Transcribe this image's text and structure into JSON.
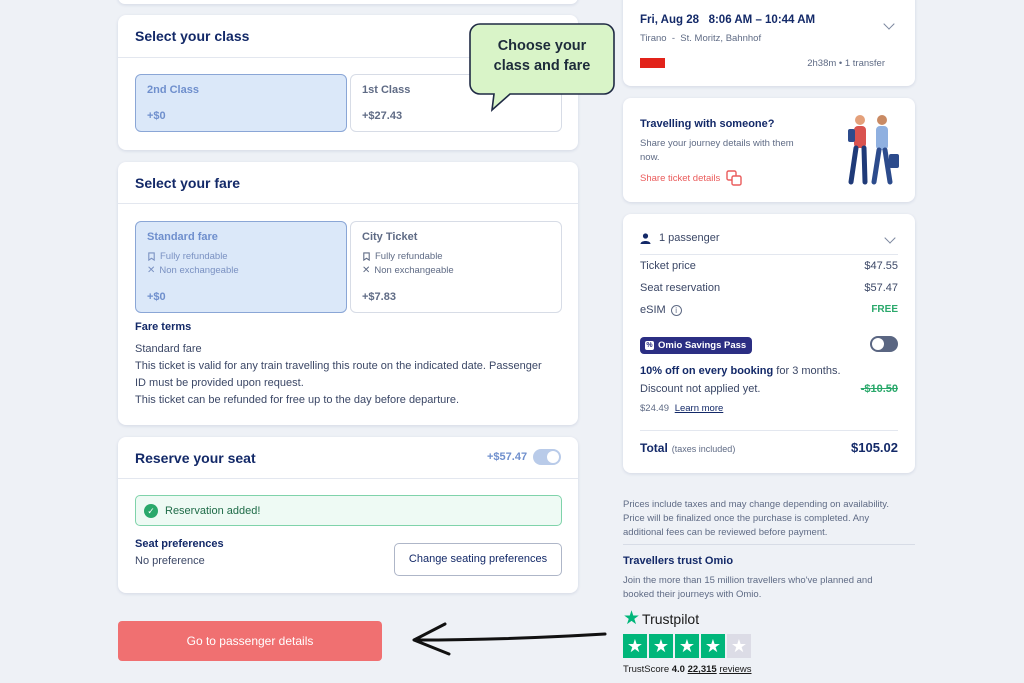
{
  "class_section": {
    "title": "Select your class",
    "options": [
      {
        "name": "2nd Class",
        "price": "+$0"
      },
      {
        "name": "1st Class",
        "price": "+$27.43"
      }
    ],
    "callout": "Choose your class and fare"
  },
  "fare_section": {
    "title": "Select your fare",
    "options": [
      {
        "name": "Standard fare",
        "feature1": "Fully refundable",
        "feature2": "Non exchangeable",
        "price": "+$0"
      },
      {
        "name": "City Ticket",
        "feature1": "Fully refundable",
        "feature2": "Non exchangeable",
        "price": "+$7.83"
      }
    ],
    "terms_title": "Fare terms",
    "terms_name": "Standard fare",
    "terms_line1": "This ticket is valid for any train travelling this route on the indicated date. Passenger",
    "terms_line2": "ID must be provided upon request.",
    "terms_line3": "This ticket can be refunded for free up to the day before departure."
  },
  "seat_section": {
    "title": "Reserve your seat",
    "price": "+$57.47",
    "toggle_on": true,
    "banner": "Reservation added!",
    "pref_title": "Seat preferences",
    "pref_value": "No preference",
    "change_button": "Change seating preferences"
  },
  "cta": {
    "label": "Go to passenger details"
  },
  "trip": {
    "date_time": "Fri, Aug 28   8:06 AM – 10:44 AM",
    "route": "Tirano  -  St. Moritz, Bahnhof",
    "duration": "2h38m • 1 transfer"
  },
  "share": {
    "title": "Travelling with someone?",
    "desc1": "Share your journey details with them",
    "desc2": "now.",
    "link": "Share ticket details"
  },
  "summary": {
    "passengers": "1 passenger",
    "rows": [
      {
        "label": "Ticket price",
        "value": "$47.55"
      },
      {
        "label": "Seat reservation",
        "value": "$57.47"
      },
      {
        "label": "eSIM",
        "value": "FREE"
      }
    ],
    "pass_badge": "Omio Savings Pass",
    "pass_line1_bold": "10% off on every booking",
    "pass_line1_rest": " for 3 months.",
    "pass_line2": "Discount not applied yet.",
    "pass_discount": "-$10.50",
    "pass_price": "$24.49",
    "learn_more": "Learn more",
    "total_label": "Total",
    "total_note": "(taxes included)",
    "total_value": "$105.02"
  },
  "disclaimer": {
    "line1": "Prices include taxes and may change depending on availability.",
    "line2": "Price will be finalized once the purchase is completed. Any",
    "line3": "additional fees can be reviewed before payment."
  },
  "trust": {
    "title": "Travellers trust Omio",
    "line1": "Join the more than 15 million travellers who've planned and",
    "line2": "booked their journeys with Omio.",
    "brand": "Trustpilot",
    "rating_stars": 4,
    "score_label": "TrustScore",
    "score_value": "4.0",
    "reviews_count": "22,315",
    "reviews_label": "reviews"
  },
  "colors": {
    "navy": "#132968",
    "selected_bg": "#dbe8f9",
    "cta": "#f07071",
    "success": "#2aa86b",
    "trustpilot": "#00b67a"
  }
}
